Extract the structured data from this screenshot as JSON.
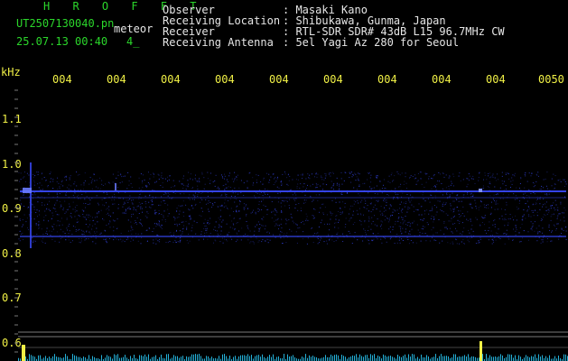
{
  "header": {
    "app_name": "H R O F F T",
    "filename": "UT2507130040.pn",
    "tag": "meteor",
    "datetime": "25.07.13 00:40",
    "counter": "4_"
  },
  "meta": [
    {
      "label": "Observer",
      "value": ": Masaki Kano"
    },
    {
      "label": "Receiving Location",
      "value": ": Shibukawa, Gunma, Japan"
    },
    {
      "label": "Receiver",
      "value": ": RTL-SDR SDR# 43dB L15 96.7MHz CW"
    },
    {
      "label": "Receiving Antenna",
      "value": ": 5el Yagi Az 280 for Seoul"
    }
  ],
  "axis": {
    "unit": "kHz",
    "freq_ticks": [
      "1.1",
      "1.0",
      "0.9",
      "0.8",
      "0.7",
      "0.6"
    ],
    "time_ticks": [
      "004",
      "004",
      "004",
      "004",
      "004",
      "004",
      "004",
      "004",
      "004",
      "0050"
    ]
  },
  "colors": {
    "signal_blue": "#3a4bff",
    "grid_line": "#7a7a7a",
    "label_yellow": "#f0f046",
    "header_green": "#2bd62b",
    "peak_cyan": "#2ad0ff"
  }
}
